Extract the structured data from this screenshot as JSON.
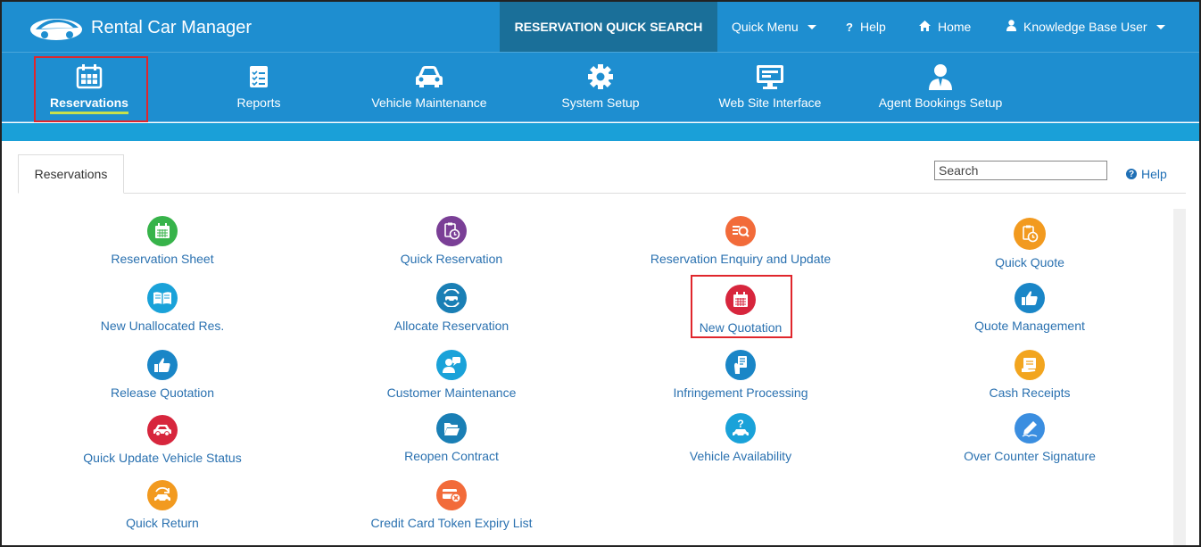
{
  "header": {
    "app_title": "Rental Car Manager",
    "quick_search": "RESERVATION QUICK SEARCH",
    "quick_menu": "Quick Menu",
    "help": "Help",
    "home": "Home",
    "user": "Knowledge Base User"
  },
  "modules": [
    {
      "label": "Reservations",
      "icon": "calendar-icon"
    },
    {
      "label": "Reports",
      "icon": "checklist-icon"
    },
    {
      "label": "Vehicle Maintenance",
      "icon": "car-icon"
    },
    {
      "label": "System Setup",
      "icon": "gear-icon"
    },
    {
      "label": "Web Site Interface",
      "icon": "monitor-icon"
    },
    {
      "label": "Agent Bookings Setup",
      "icon": "agent-icon"
    }
  ],
  "tab": {
    "label": "Reservations"
  },
  "search": {
    "placeholder": "Search"
  },
  "help_link": "Help",
  "items": [
    {
      "label": "Reservation Sheet",
      "color": "#37b34a",
      "icon": "calendar-grid-icon"
    },
    {
      "label": "Quick Reservation",
      "color": "#7a3f96",
      "icon": "clipboard-clock-icon"
    },
    {
      "label": "Reservation Enquiry and Update",
      "color": "#f26b3a",
      "icon": "search-list-icon"
    },
    {
      "label": "Quick Quote",
      "color": "#f29a1f",
      "icon": "clipboard-clock-icon"
    },
    {
      "label": "New Unallocated Res.",
      "color": "#1aa2d9",
      "icon": "book-icon"
    },
    {
      "label": "Allocate Reservation",
      "color": "#1a7fb5",
      "icon": "car-refresh-icon"
    },
    {
      "label": "New Quotation",
      "color": "#d7263d",
      "icon": "calendar-grid-icon"
    },
    {
      "label": "Quote Management",
      "color": "#1a86c7",
      "icon": "thumbs-up-icon"
    },
    {
      "label": "Release Quotation",
      "color": "#1a86c7",
      "icon": "thumbs-up-icon"
    },
    {
      "label": "Customer Maintenance",
      "color": "#1aa2d9",
      "icon": "person-chat-icon"
    },
    {
      "label": "Infringement Processing",
      "color": "#1a86c7",
      "icon": "document-hand-icon"
    },
    {
      "label": "Cash Receipts",
      "color": "#f2a51f",
      "icon": "receipt-icon"
    },
    {
      "label": "Quick Update Vehicle Status",
      "color": "#d7263d",
      "icon": "car-icon"
    },
    {
      "label": "Reopen Contract",
      "color": "#1a7fb5",
      "icon": "folder-open-icon"
    },
    {
      "label": "Vehicle Availability",
      "color": "#1aa2d9",
      "icon": "car-question-icon"
    },
    {
      "label": "Over Counter Signature",
      "color": "#3b8ee0",
      "icon": "pen-signature-icon"
    },
    {
      "label": "Quick Return",
      "color": "#f29a1f",
      "icon": "car-return-icon"
    },
    {
      "label": "Credit Card Token Expiry List",
      "color": "#f26b3a",
      "icon": "credit-card-x-icon"
    }
  ]
}
